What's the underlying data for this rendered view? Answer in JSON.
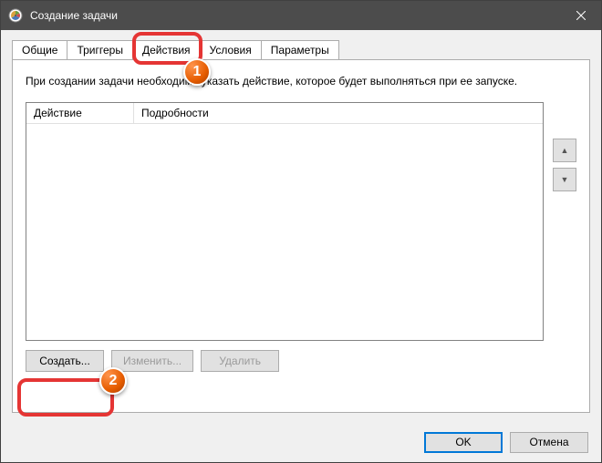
{
  "titlebar": {
    "title": "Создание задачи"
  },
  "tabs": {
    "general": "Общие",
    "triggers": "Триггеры",
    "actions": "Действия",
    "conditions": "Условия",
    "parameters": "Параметры"
  },
  "panel": {
    "instruction": "При создании задачи необходимо указать действие, которое будет выполняться при ее запуске.",
    "col_action": "Действие",
    "col_details": "Подробности",
    "btn_create": "Создать...",
    "btn_edit": "Изменить...",
    "btn_delete": "Удалить"
  },
  "footer": {
    "ok": "OK",
    "cancel": "Отмена"
  },
  "badges": {
    "one": "1",
    "two": "2"
  },
  "arrows": {
    "up": "▲",
    "down": "▼"
  }
}
